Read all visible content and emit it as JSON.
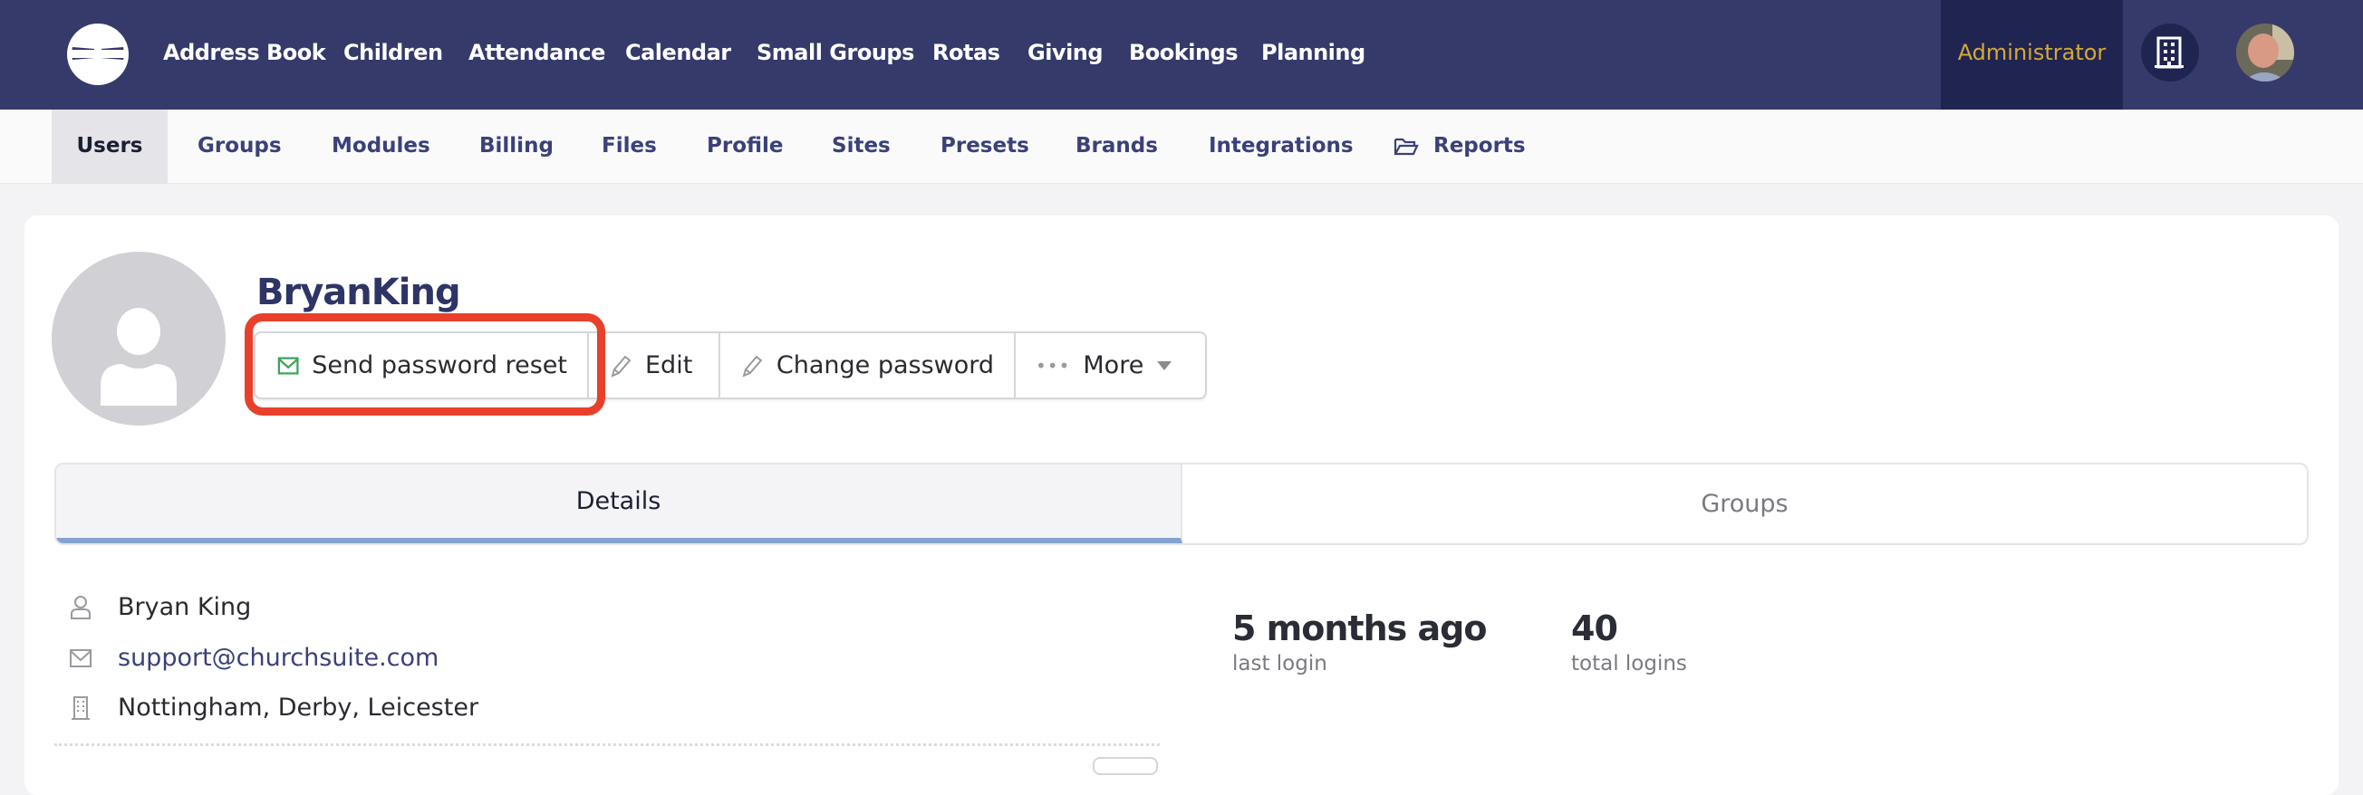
{
  "topnav": {
    "items": [
      "Address Book",
      "Children",
      "Attendance",
      "Calendar",
      "Small Groups",
      "Rotas",
      "Giving",
      "Bookings",
      "Planning"
    ],
    "role": "Administrator"
  },
  "subnav": {
    "items": [
      "Users",
      "Groups",
      "Modules",
      "Billing",
      "Files",
      "Profile",
      "Sites",
      "Presets",
      "Brands",
      "Integrations",
      "Reports"
    ],
    "active": "Users"
  },
  "user": {
    "username": "BryanKing",
    "full_name": "Bryan King",
    "email": "support@churchsuite.com",
    "sites": "Nottingham, Derby, Leicester"
  },
  "actions": {
    "send_reset": "Send password reset",
    "edit": "Edit",
    "change_password": "Change password",
    "more": "More"
  },
  "tabs": [
    "Details",
    "Groups"
  ],
  "stats": {
    "last_login_value": "5 months ago",
    "last_login_label": "last login",
    "total_logins_value": "40",
    "total_logins_label": "total logins"
  },
  "colors": {
    "nav_bg": "#353a6a",
    "admin_bg": "#1f2451",
    "admin_text": "#d4a935",
    "highlight": "#e8402a",
    "link": "#3b4178",
    "tab_active_border": "#84a3d1"
  }
}
